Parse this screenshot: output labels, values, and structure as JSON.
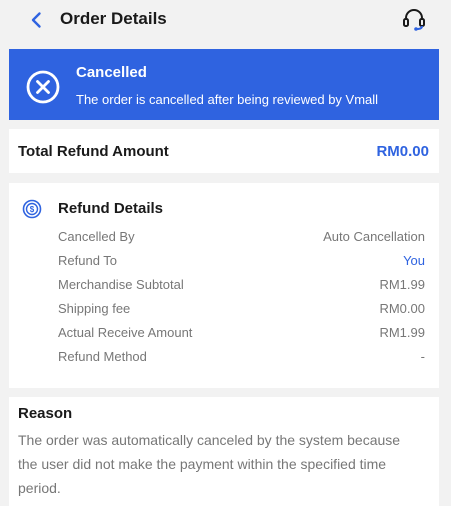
{
  "header": {
    "title": "Order Details",
    "back_icon": "chevron-left-icon",
    "support_icon": "headset-icon"
  },
  "status": {
    "title": "Cancelled",
    "description": "The order is cancelled after being reviewed by Vmall",
    "icon": "x-circle-icon",
    "background_color": "#2f63e0"
  },
  "total_refund": {
    "label": "Total Refund Amount",
    "value": "RM0.00",
    "value_color": "#2f63e0"
  },
  "refund_details": {
    "title": "Refund Details",
    "icon": "coin-icon",
    "rows": [
      {
        "label": "Cancelled By",
        "value": "Auto Cancellation"
      },
      {
        "label": "Refund To",
        "value": "You"
      },
      {
        "label": "Merchandise Subtotal",
        "value": "RM1.99"
      },
      {
        "label": "Shipping fee",
        "value": "RM0.00"
      },
      {
        "label": "Actual Receive Amount",
        "value": "RM1.99"
      },
      {
        "label": "Refund Method",
        "value": "-"
      }
    ]
  },
  "reason": {
    "title": "Reason",
    "text": "The order was automatically canceled by the system because the user did not make the payment within the specified time period."
  }
}
